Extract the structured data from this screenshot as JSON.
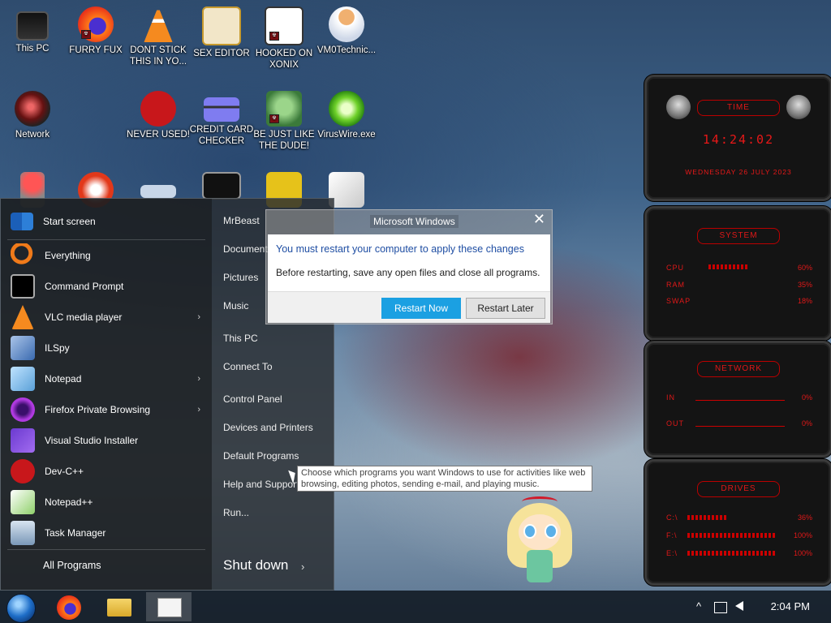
{
  "desktop": {
    "icons": [
      {
        "label": "This PC"
      },
      {
        "label": "FURRY FUX"
      },
      {
        "label": "DONT STICK THIS IN YO..."
      },
      {
        "label": "SEX EDITOR"
      },
      {
        "label": "HOOKED ON XONIX"
      },
      {
        "label": "VM0Technic..."
      },
      {
        "label": "Network"
      },
      {
        "label": "NEVER USED!"
      },
      {
        "label": "CREDIT CARD CHECKER"
      },
      {
        "label": "BE JUST LIKE THE DUDE!"
      },
      {
        "label": "VirusWire.exe"
      }
    ]
  },
  "start_menu": {
    "items": [
      {
        "label": "Start screen"
      },
      {
        "label": "Everything"
      },
      {
        "label": "Command Prompt"
      },
      {
        "label": "VLC media player"
      },
      {
        "label": "ILSpy"
      },
      {
        "label": "Notepad"
      },
      {
        "label": "Firefox Private Browsing"
      },
      {
        "label": "Visual Studio Installer"
      },
      {
        "label": "Dev-C++"
      },
      {
        "label": "Notepad++"
      },
      {
        "label": "Task Manager"
      }
    ],
    "all_programs": "All Programs",
    "right_items": [
      {
        "label": "MrBeast"
      },
      {
        "label": "Documents"
      },
      {
        "label": "Pictures"
      },
      {
        "label": "Music"
      },
      {
        "label": "This PC"
      },
      {
        "label": "Connect To"
      },
      {
        "label": "Control Panel"
      },
      {
        "label": "Devices and Printers"
      },
      {
        "label": "Default Programs"
      },
      {
        "label": "Help and Support"
      },
      {
        "label": "Run..."
      }
    ],
    "shutdown": "Shut down",
    "arrow": "›"
  },
  "dialog": {
    "title": "Microsoft Windows",
    "close": "✕",
    "main": "You must restart your computer to apply these changes",
    "sub": "Before restarting, save any open files and close all programs.",
    "restart_now": "Restart Now",
    "restart_later": "Restart Later"
  },
  "tooltip": "Choose which programs you want Windows to use for activities like web browsing, editing photos, sending e-mail, and playing music.",
  "gadget": {
    "time_title": "TIME",
    "clock": "14:24:02",
    "date": "WEDNESDAY 26 JULY 2023",
    "system_title": "SYSTEM",
    "cpu_label": "CPU",
    "cpu_val": "60%",
    "ram_label": "RAM",
    "ram_val": "35%",
    "swap_label": "SWAP",
    "swap_val": "18%",
    "network_title": "NETWORK",
    "in_label": "IN",
    "in_val": "0%",
    "out_label": "OUT",
    "out_val": "0%",
    "drives_title": "DRIVES",
    "c_label": "C:\\",
    "c_val": "36%",
    "f_label": "F:\\",
    "f_val": "100%",
    "e_label": "E:\\",
    "e_val": "100%"
  },
  "taskbar": {
    "clock": "2:04 PM",
    "tray_up": "^"
  },
  "colors": {
    "accent": "#1ba0e2",
    "gadget_red": "#e01818"
  }
}
